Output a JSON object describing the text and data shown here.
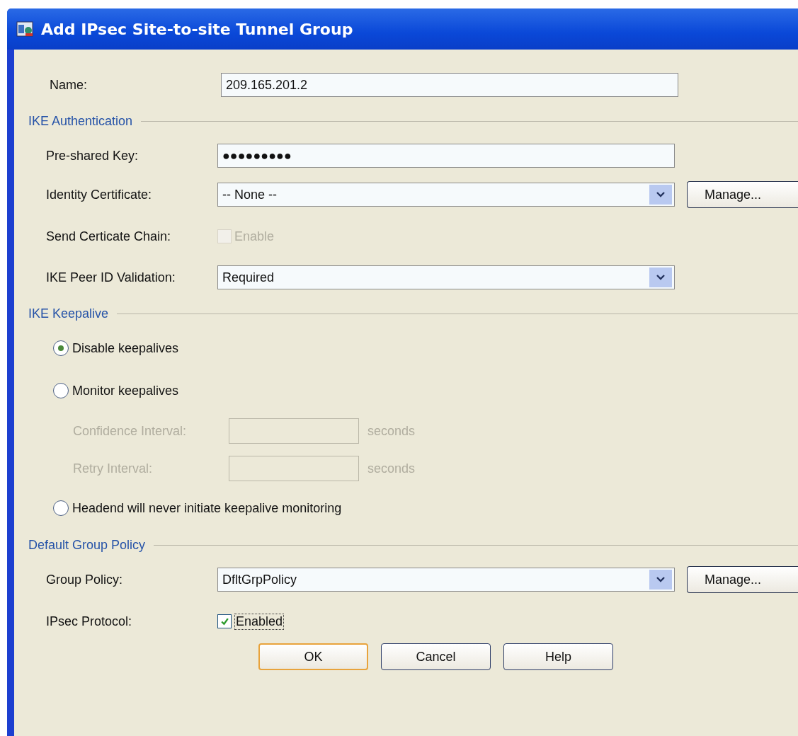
{
  "window": {
    "title": "Add IPsec Site-to-site Tunnel Group"
  },
  "name_field": {
    "label": "Name:",
    "value": "209.165.201.2"
  },
  "sections": [
    {
      "title": "IKE Authentication",
      "rows": [
        {
          "kind": "text",
          "label": "Pre-shared Key:",
          "value": "●●●●●●●●●"
        },
        {
          "kind": "select",
          "label": "Identity Certificate:",
          "value": "-- None --",
          "button": "Manage..."
        },
        {
          "kind": "checkbox",
          "label": "Send Certicate Chain:",
          "option": "Enable",
          "checked": false,
          "disabled": true
        },
        {
          "kind": "select",
          "label": "IKE Peer ID Validation:",
          "value": "Required"
        }
      ]
    },
    {
      "title": "IKE Keepalive",
      "rows": [
        {
          "kind": "radio",
          "label": "Disable keepalives",
          "selected": true
        },
        {
          "kind": "radio",
          "label": "Monitor keepalives",
          "selected": false
        },
        {
          "kind": "interval",
          "label": "Confidence Interval:",
          "unit": "seconds",
          "disabled": true
        },
        {
          "kind": "interval",
          "label": "Retry Interval:",
          "unit": "seconds",
          "disabled": true
        },
        {
          "kind": "radio",
          "label": "Headend will never initiate keepalive monitoring",
          "selected": false
        }
      ]
    },
    {
      "title": "Default Group Policy",
      "rows": [
        {
          "kind": "select",
          "label": "Group Policy:",
          "value": "DfltGrpPolicy",
          "button": "Manage..."
        },
        {
          "kind": "checkbox",
          "label": "IPsec Protocol:",
          "option": "Enabled",
          "checked": true,
          "disabled": false
        }
      ]
    }
  ],
  "buttons": [
    {
      "label": "OK",
      "default": true
    },
    {
      "label": "Cancel",
      "default": false
    },
    {
      "label": "Help",
      "default": false
    }
  ]
}
